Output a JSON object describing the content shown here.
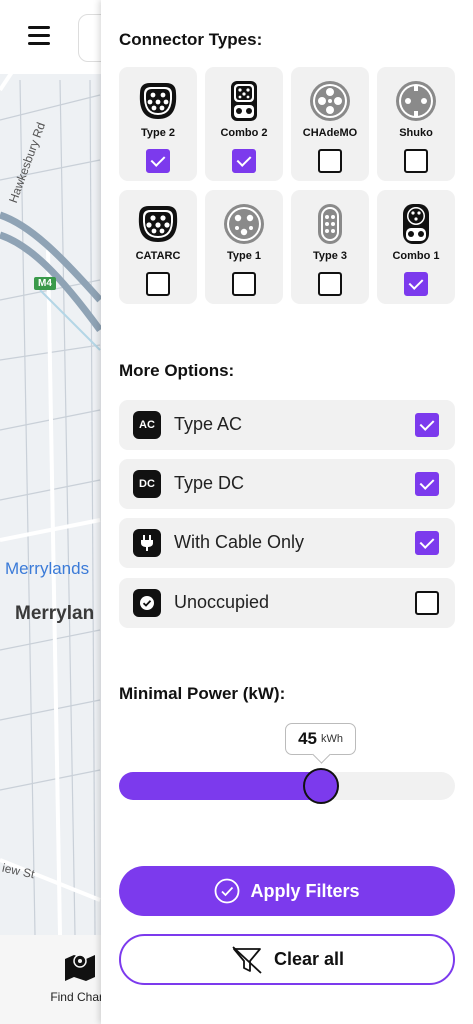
{
  "map": {
    "street_1": "Hawkesbury Rd",
    "street_2": "iew St",
    "motorway_badge": "M4",
    "suburb_label_blue": "Merrylands",
    "suburb_label": "Merrylan"
  },
  "bottom_nav": {
    "find_label": "Find Charg"
  },
  "connectors": {
    "title": "Connector Types:",
    "items": [
      {
        "name": "Type 2",
        "checked": true,
        "icon": "type2-icon"
      },
      {
        "name": "Combo 2",
        "checked": true,
        "icon": "combo2-icon"
      },
      {
        "name": "CHAdeMO",
        "checked": false,
        "icon": "chademo-icon"
      },
      {
        "name": "Shuko",
        "checked": false,
        "icon": "shuko-icon"
      },
      {
        "name": "CATARC",
        "checked": false,
        "icon": "catarc-icon"
      },
      {
        "name": "Type 1",
        "checked": false,
        "icon": "type1-icon"
      },
      {
        "name": "Type 3",
        "checked": false,
        "icon": "type3-icon"
      },
      {
        "name": "Combo 1",
        "checked": true,
        "icon": "combo1-icon"
      }
    ]
  },
  "options": {
    "title": "More Options:",
    "items": [
      {
        "badge": "AC",
        "label": "Type AC",
        "checked": true
      },
      {
        "badge": "DC",
        "label": "Type DC",
        "checked": true
      },
      {
        "badge": "",
        "label": "With Cable Only",
        "checked": true,
        "icon": "plug-icon"
      },
      {
        "badge": "",
        "label": "Unoccupied",
        "checked": false,
        "icon": "check-circle-icon"
      }
    ]
  },
  "power": {
    "title": "Minimal Power (kW):",
    "value": "45",
    "unit": "kWh",
    "fraction": 0.6
  },
  "actions": {
    "apply_label": "Apply Filters",
    "clear_label": "Clear all"
  },
  "colors": {
    "accent": "#7c3aed",
    "card_bg": "#f1f1f1"
  }
}
